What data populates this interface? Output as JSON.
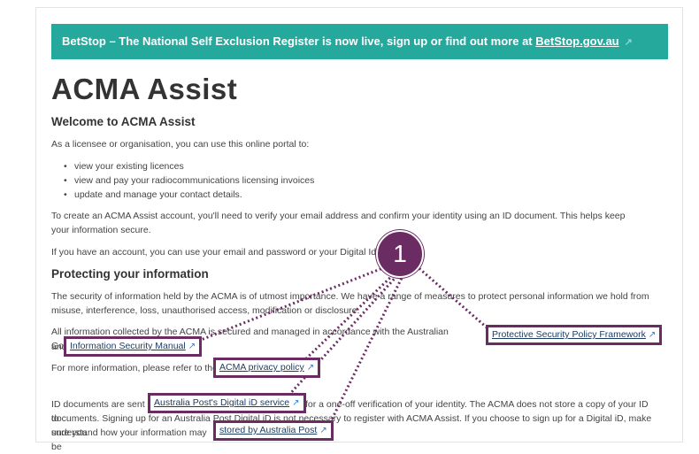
{
  "banner": {
    "text": "BetStop – The National Self Exclusion Register is now live, sign up or find out more at ",
    "link": "BetStop.gov.au",
    "icon": "external-link-icon"
  },
  "page": {
    "title": "ACMA Assist",
    "welcome_heading": "Welcome to ACMA Assist",
    "intro": "As a licensee or organisation, you can use this online portal to:",
    "bullets": [
      "view your existing licences",
      "view and pay your radiocommunications licensing invoices",
      "update and manage your contact details."
    ],
    "create_account": "To create an ACMA Assist account, you'll need to verify your email address and confirm your identity using an ID document. This helps keep your information secure.",
    "have_account": "If you have an account, you can use your email and password or your Digital Ident",
    "protect_heading": "Protecting your information",
    "security_p1": "The security of information held by the ACMA is of utmost importance. We have a range of measures to protect personal information we hold from misuse, interference, loss, unauthorised access, modification or disclosure.",
    "security_p2_start": "All information collected by the ACMA is secured and managed in accordance with the Australian Government's",
    "security_p2_and": "and",
    "more_info": "For more information, please refer to the",
    "id_docs_1a": "ID documents are sent to",
    "id_docs_1b": "for a one-off verification of your identity. The ACMA does not store a copy of your ID",
    "id_docs_2": "documents. Signing up for an Australia Post Digital iD is not necessary to register with ACMA Assist. If you choose to sign up for a Digital iD, make sure you",
    "id_docs_3": "understand how your information may be"
  },
  "links": {
    "pspf": "Protective Security Policy Framework",
    "ism": "Information Security Manual",
    "privacy": "ACMA privacy policy",
    "digital_id": "Australia Post's Digital iD service",
    "stored": "stored by Australia Post"
  },
  "callout": {
    "number": "1"
  },
  "colors": {
    "banner": "#25a99c",
    "highlight": "#6b2c63",
    "link": "#1d3d63"
  }
}
